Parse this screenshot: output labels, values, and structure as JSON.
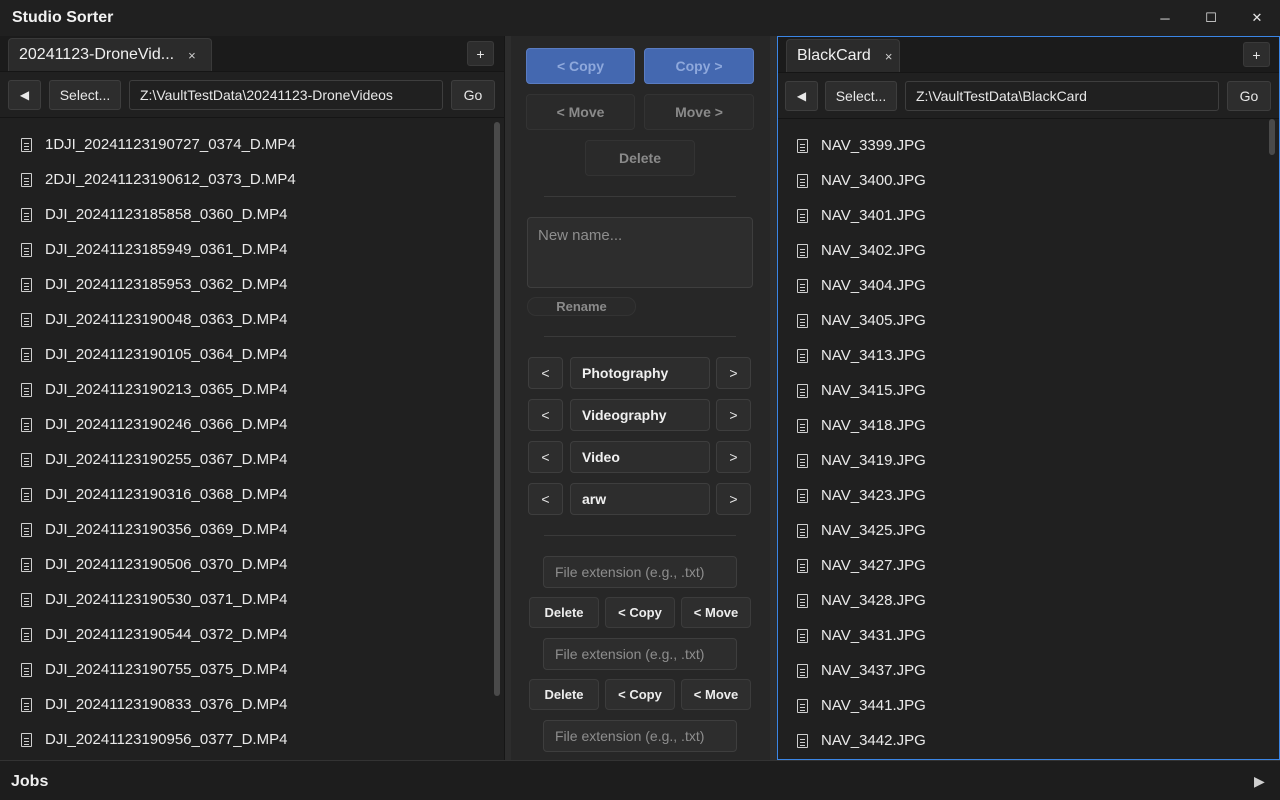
{
  "app": {
    "title": "Studio Sorter"
  },
  "window_controls": {
    "minimize": "─",
    "maximize": "☐",
    "close": "✕"
  },
  "left_pane": {
    "tab_label": "20241123-DroneVid...",
    "tab_close": "×",
    "add_tab": "+",
    "back": "◀",
    "select_label": "Select...",
    "path": "Z:\\VaultTestData\\20241123-DroneVideos",
    "go_label": "Go",
    "files": [
      "1DJI_20241123190727_0374_D.MP4",
      "2DJI_20241123190612_0373_D.MP4",
      "DJI_20241123185858_0360_D.MP4",
      "DJI_20241123185949_0361_D.MP4",
      "DJI_20241123185953_0362_D.MP4",
      "DJI_20241123190048_0363_D.MP4",
      "DJI_20241123190105_0364_D.MP4",
      "DJI_20241123190213_0365_D.MP4",
      "DJI_20241123190246_0366_D.MP4",
      "DJI_20241123190255_0367_D.MP4",
      "DJI_20241123190316_0368_D.MP4",
      "DJI_20241123190356_0369_D.MP4",
      "DJI_20241123190506_0370_D.MP4",
      "DJI_20241123190530_0371_D.MP4",
      "DJI_20241123190544_0372_D.MP4",
      "DJI_20241123190755_0375_D.MP4",
      "DJI_20241123190833_0376_D.MP4",
      "DJI_20241123190956_0377_D.MP4"
    ]
  },
  "right_pane": {
    "tab_label": "BlackCard",
    "tab_close": "×",
    "add_tab": "+",
    "back": "◀",
    "select_label": "Select...",
    "path": "Z:\\VaultTestData\\BlackCard",
    "go_label": "Go",
    "files": [
      "NAV_3399.JPG",
      "NAV_3400.JPG",
      "NAV_3401.JPG",
      "NAV_3402.JPG",
      "NAV_3404.JPG",
      "NAV_3405.JPG",
      "NAV_3413.JPG",
      "NAV_3415.JPG",
      "NAV_3418.JPG",
      "NAV_3419.JPG",
      "NAV_3423.JPG",
      "NAV_3425.JPG",
      "NAV_3427.JPG",
      "NAV_3428.JPG",
      "NAV_3431.JPG",
      "NAV_3437.JPG",
      "NAV_3441.JPG",
      "NAV_3442.JPG"
    ]
  },
  "middle": {
    "copy_left": "< Copy",
    "copy_right": "Copy >",
    "move_left": "< Move",
    "move_right": "Move >",
    "delete": "Delete",
    "rename_placeholder": "New name...",
    "rename": "Rename",
    "arrow_left": "<",
    "arrow_right": ">",
    "categories": [
      "Photography",
      "Videography",
      "Video",
      "arw"
    ],
    "ext_placeholder": "File extension (e.g., .txt)",
    "ext_rows": [
      {
        "delete": "Delete",
        "copy": "< Copy",
        "move": "< Move"
      },
      {
        "delete": "Delete",
        "copy": "< Copy",
        "move": "< Move"
      }
    ]
  },
  "jobs": {
    "label": "Jobs",
    "toggle": "▶"
  },
  "colors": {
    "accent": "#3b86e6",
    "copy_button": "#4468b0",
    "background": "#202020"
  }
}
